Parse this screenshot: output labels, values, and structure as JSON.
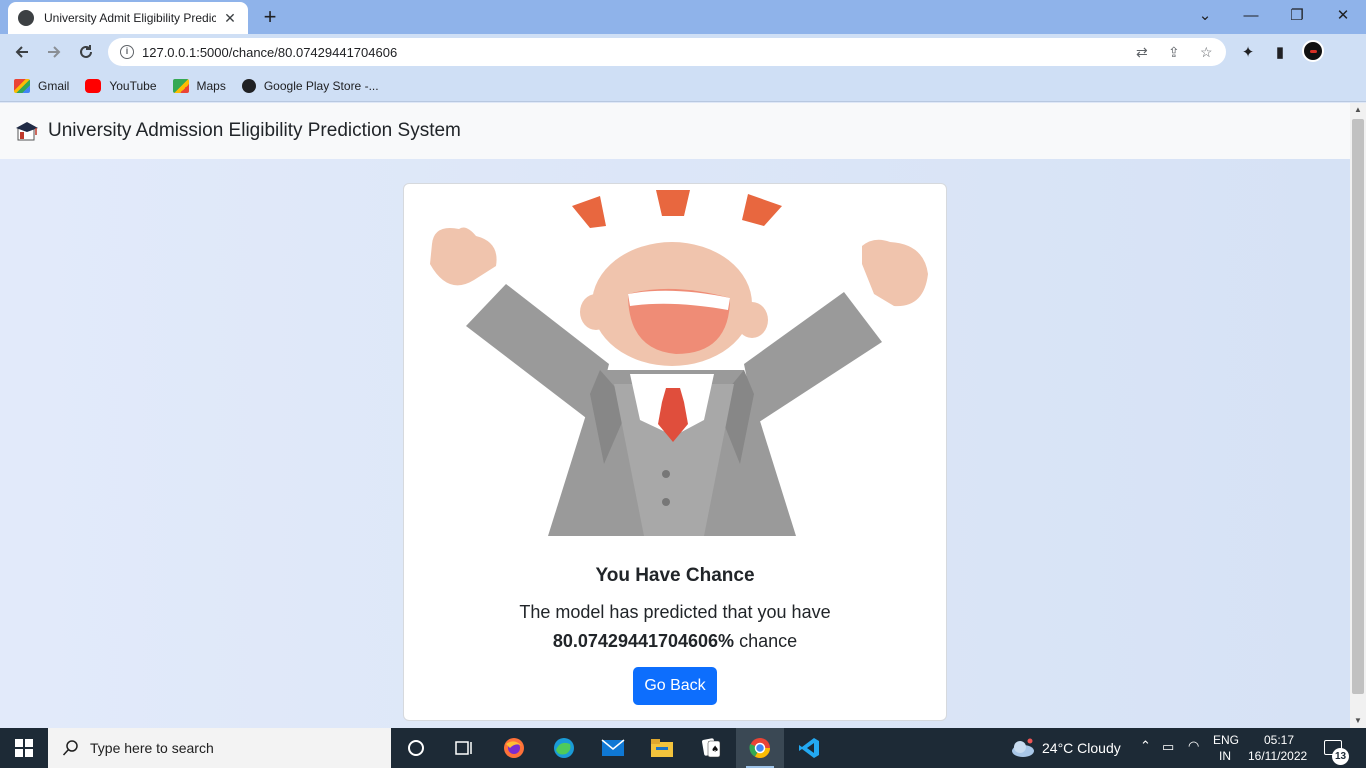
{
  "browser": {
    "tab_title": "University Admit Eligibility Predic",
    "tab_close": "✕",
    "new_tab": "+",
    "url": "127.0.0.1:5000/chance/80.07429441704606",
    "window_controls": {
      "dropdown": "⌄",
      "minimize": "—",
      "maximize": "❐",
      "close": "✕"
    }
  },
  "bookmarks": [
    {
      "label": "Gmail",
      "icon": "gmail-icon"
    },
    {
      "label": "YouTube",
      "icon": "youtube-icon"
    },
    {
      "label": "Maps",
      "icon": "maps-icon"
    },
    {
      "label": "Google Play Store -...",
      "icon": "play-store-icon"
    }
  ],
  "navbar": {
    "brand": "University Admission Eligibility Prediction System"
  },
  "result": {
    "title": "You Have Chance",
    "text_prefix": "The model has predicted that you have",
    "chance_value": "80.07429441704606%",
    "text_suffix": "chance",
    "button": "Go Back"
  },
  "taskbar": {
    "search_placeholder": "Type here to search",
    "weather": "24°C  Cloudy",
    "lang_top": "ENG",
    "lang_bottom": "IN",
    "time": "05:17",
    "date": "16/11/2022",
    "notifications": "13"
  },
  "colors": {
    "primary_button": "#0d6efd",
    "tab_strip": "#8fb3ea",
    "toolbar": "#cfdff5",
    "taskbar": "#1d2a36"
  }
}
